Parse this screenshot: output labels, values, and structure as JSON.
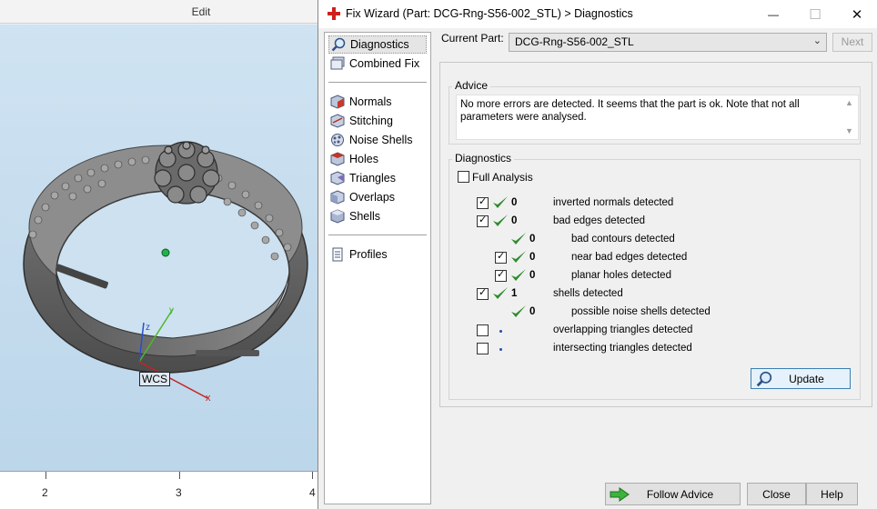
{
  "background_app": {
    "ribbon_label": "Edit",
    "ruler_labels": [
      "2",
      "3",
      "4"
    ],
    "wcs_label": "WCS",
    "axis_labels": {
      "x": "x",
      "y": "y",
      "z": "z"
    }
  },
  "dialog": {
    "title": "Fix Wizard (Part: DCG-Rng-S56-002_STL) > Diagnostics",
    "window_controls": {
      "minimize": "—",
      "maximize": "☐",
      "close": "✕"
    },
    "nav": {
      "group1": [
        {
          "label": "Diagnostics",
          "icon": "magnifier-icon",
          "selected": true
        },
        {
          "label": "Combined Fix",
          "icon": "combined-fix-icon",
          "selected": false
        }
      ],
      "group2": [
        {
          "label": "Normals",
          "icon": "normals-cube-icon"
        },
        {
          "label": "Stitching",
          "icon": "stitching-cube-icon"
        },
        {
          "label": "Noise Shells",
          "icon": "noise-shells-icon"
        },
        {
          "label": "Holes",
          "icon": "holes-cube-icon"
        },
        {
          "label": "Triangles",
          "icon": "triangles-cube-icon"
        },
        {
          "label": "Overlaps",
          "icon": "overlaps-cube-icon"
        },
        {
          "label": "Shells",
          "icon": "shells-cube-icon"
        }
      ],
      "group3": [
        {
          "label": "Profiles",
          "icon": "profiles-document-icon"
        }
      ]
    },
    "current_part_label": "Current Part:",
    "current_part_value": "DCG-Rng-S56-002_STL",
    "next_label": "Next",
    "advice": {
      "title": "Advice",
      "text": "No more errors are detected. It seems that the part is ok. Note that not all parameters were analysed."
    },
    "diagnostics": {
      "title": "Diagnostics",
      "full_analysis_label": "Full Analysis",
      "full_analysis_checked": false,
      "rows": [
        {
          "checkbox": true,
          "checked": true,
          "status": "ok",
          "count": "0",
          "label": "inverted normals detected",
          "indent": 0
        },
        {
          "checkbox": true,
          "checked": true,
          "status": "ok",
          "count": "0",
          "label": "bad edges detected",
          "indent": 0
        },
        {
          "checkbox": false,
          "checked": false,
          "status": "ok",
          "count": "0",
          "label": "bad contours detected",
          "indent": 1
        },
        {
          "checkbox": true,
          "checked": true,
          "status": "ok",
          "count": "0",
          "label": "near bad edges detected",
          "indent": 1
        },
        {
          "checkbox": true,
          "checked": true,
          "status": "ok",
          "count": "0",
          "label": "planar holes detected",
          "indent": 1
        },
        {
          "checkbox": true,
          "checked": true,
          "status": "ok",
          "count": "1",
          "label": "shells detected",
          "indent": 0
        },
        {
          "checkbox": false,
          "checked": false,
          "status": "ok",
          "count": "0",
          "label": "possible noise shells detected",
          "indent": 1
        },
        {
          "checkbox": true,
          "checked": false,
          "status": "pending",
          "count": "",
          "label": "overlapping triangles detected",
          "indent": 0
        },
        {
          "checkbox": true,
          "checked": false,
          "status": "pending",
          "count": "",
          "label": "intersecting triangles detected",
          "indent": 0
        }
      ],
      "update_label": "Update"
    },
    "footer": {
      "follow_advice_label": "Follow Advice",
      "close_label": "Close",
      "help_label": "Help"
    }
  },
  "colors": {
    "check_green": "#2e8b2e",
    "pending_dot": "#2a4ca8",
    "accent_blue": "#3c7fb1",
    "title_icon_red": "#d0201e"
  }
}
